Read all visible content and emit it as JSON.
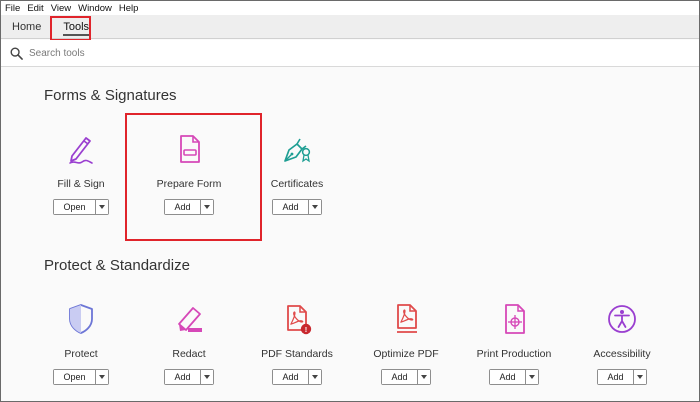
{
  "menu": {
    "items": [
      {
        "label": "File"
      },
      {
        "label": "Edit"
      },
      {
        "label": "View"
      },
      {
        "label": "Window"
      },
      {
        "label": "Help"
      }
    ]
  },
  "tabs": [
    {
      "label": "Home"
    },
    {
      "label": "Tools"
    }
  ],
  "search": {
    "placeholder": "Search tools",
    "value": ""
  },
  "sections": [
    {
      "title": "Forms & Signatures",
      "tools": [
        {
          "label": "Fill & Sign",
          "button": "Open",
          "icon": "fill-sign-icon"
        },
        {
          "label": "Prepare Form",
          "button": "Add",
          "icon": "prepare-form-icon"
        },
        {
          "label": "Certificates",
          "button": "Add",
          "icon": "certificates-icon"
        }
      ]
    },
    {
      "title": "Protect & Standardize",
      "tools": [
        {
          "label": "Protect",
          "button": "Open",
          "icon": "shield-icon"
        },
        {
          "label": "Redact",
          "button": "Add",
          "icon": "redact-marker-icon"
        },
        {
          "label": "PDF Standards",
          "button": "Add",
          "icon": "pdf-standards-icon"
        },
        {
          "label": "Optimize PDF",
          "button": "Add",
          "icon": "optimize-pdf-icon"
        },
        {
          "label": "Print Production",
          "button": "Add",
          "icon": "print-production-icon"
        },
        {
          "label": "Accessibility",
          "button": "Add",
          "icon": "accessibility-icon"
        }
      ]
    }
  ],
  "colors": {
    "purple": "#9a3fd0",
    "magenta": "#d648b8",
    "teal": "#1e9e93",
    "blue": "#6d76d6",
    "pdf_red": "#e04a4a",
    "highlight": "#e0242b"
  }
}
